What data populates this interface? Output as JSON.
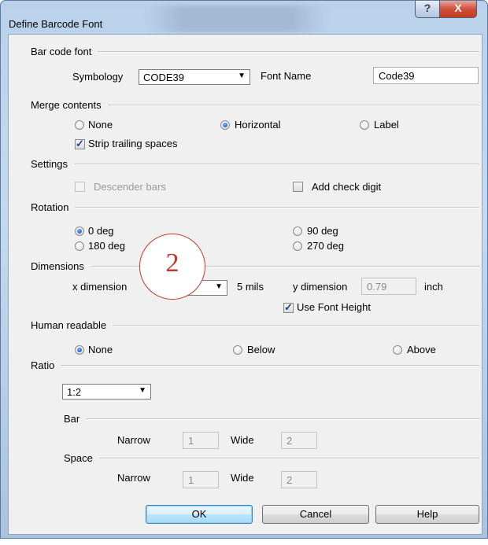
{
  "window": {
    "title": "Define Barcode Font",
    "help_glyph": "?",
    "close_glyph": "X"
  },
  "bar_code_font": {
    "heading": "Bar code font",
    "symbology_label": "Symbology",
    "symbology_value": "CODE39",
    "font_name_label": "Font Name",
    "font_name_value": "Code39"
  },
  "merge_contents": {
    "heading": "Merge contents",
    "options": [
      "None",
      "Horizontal",
      "Label"
    ],
    "selected": "Horizontal",
    "strip_label": "Strip trailing spaces",
    "strip_checked": true
  },
  "settings": {
    "heading": "Settings",
    "descender_label": "Descender bars",
    "descender_checked": false,
    "check_digit_label": "Add check digit",
    "check_digit_checked": false
  },
  "rotation": {
    "heading": "Rotation",
    "options": [
      "0 deg",
      "180 deg",
      "90 deg",
      "270 deg"
    ],
    "selected": "0 deg"
  },
  "dimensions": {
    "heading": "Dimensions",
    "x_label": "x dimension",
    "x_units": "5 mils",
    "y_label": "y dimension",
    "y_value": "0.79",
    "y_units": "inch",
    "use_font_height_label": "Use Font Height",
    "use_font_height_checked": true
  },
  "human_readable": {
    "heading": "Human readable",
    "options": [
      "None",
      "Below",
      "Above"
    ],
    "selected": "None"
  },
  "ratio": {
    "heading": "Ratio",
    "value": "1:2",
    "bar": {
      "heading": "Bar",
      "narrow_label": "Narrow",
      "narrow_value": "1",
      "wide_label": "Wide",
      "wide_value": "2"
    },
    "space": {
      "heading": "Space",
      "narrow_label": "Narrow",
      "narrow_value": "1",
      "wide_label": "Wide",
      "wide_value": "2"
    }
  },
  "buttons": {
    "ok": "OK",
    "cancel": "Cancel",
    "help": "Help"
  },
  "callout": {
    "number": "2"
  },
  "colors": {
    "accent": "#1e5fc8",
    "callout": "#c0392b",
    "close": "#c23a21"
  }
}
